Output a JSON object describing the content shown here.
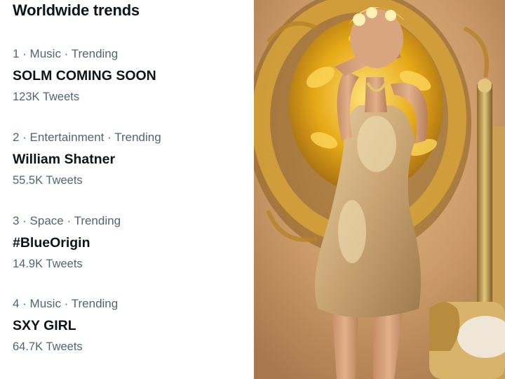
{
  "panel": {
    "title": "Worldwide trends",
    "trends": [
      {
        "meta": "1 · Music · Trending",
        "name": "SOLM COMING SOON",
        "count": "123K Tweets"
      },
      {
        "meta": "2 · Entertainment · Trending",
        "name": "William Shatner",
        "count": "55.5K Tweets"
      },
      {
        "meta": "3 · Space · Trending",
        "name": "#BlueOrigin",
        "count": "14.9K Tweets"
      },
      {
        "meta": "4 · Music · Trending",
        "name": "SXY GIRL",
        "count": "64.7K Tweets"
      }
    ]
  },
  "colors": {
    "text_primary": "#0f1419",
    "text_secondary": "#536471",
    "photo_background": "#c79a6a",
    "gold": "#e0b12a",
    "dress": "#c9a574"
  }
}
